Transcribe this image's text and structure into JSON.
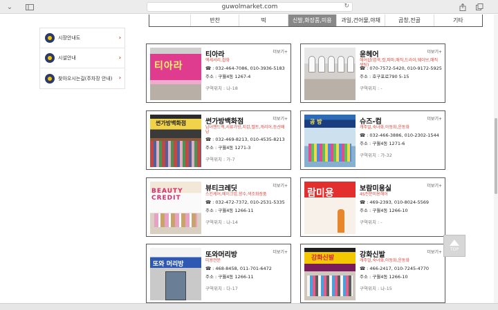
{
  "browser": {
    "url": "guwolmarket.com"
  },
  "categories": [
    {
      "label": "반찬"
    },
    {
      "label": "떡"
    },
    {
      "label": "신발,화장품,미용",
      "active": true
    },
    {
      "label": "과일,건어물,야채"
    },
    {
      "label": "곱창,전골"
    },
    {
      "label": "기타"
    }
  ],
  "sidebar": {
    "items": [
      {
        "label": "시장안내도"
      },
      {
        "label": "시설안내"
      },
      {
        "label": "찾아오시는길(주차장 안내)"
      }
    ]
  },
  "more_label": "더보기+",
  "stores": [
    {
      "name": "티아라",
      "items": "액세서리,잡화",
      "phone": "☎ : 032-464-7086, 010-3936-5183",
      "addr": "주소 : 구월4동 1267-4",
      "zone": "구역위치 : 나-18",
      "sign": "티아라"
    },
    {
      "name": "윤헤어",
      "items": "헤어샵(염색,컷,파마,매직,드라이,웨이브,매직셋팅)",
      "phone": "☎ : 070-7572-5420, 010-9172-5925",
      "addr": "주소 : 호구포로790 5-15",
      "zone": "구역위치 : -",
      "sign": ""
    },
    {
      "name": "썬가방백화점",
      "items": "남녀핸드백,서류가방,지갑,벨트,캐리어,등산배낭",
      "phone": "☎ : 032-469-8213, 010-4535-8213",
      "addr": "주소 : 구월4동 1271-3",
      "zone": "구역위치 : 가-7",
      "sign": "썬가방백화점"
    },
    {
      "name": "슈즈-컴",
      "items": "캐주얼,숙녀화,아동화,운동화",
      "phone": "☎ : 032-466-3886, 010-2302-1544",
      "addr": "주소 : 구월4동 1271-6",
      "zone": "구역위치 : 가-32",
      "sign": "공 방"
    },
    {
      "name": "뷰티크레딧",
      "items": "스킨케어,메이크업,향수,색조화장품",
      "phone": "☎ : 032-472-7372, 010-2531-5335",
      "addr": "주소 : 구월4동 1266-11",
      "zone": "구역위치 : 나-14",
      "sign": "BEAUTY CREDIT"
    },
    {
      "name": "보람미용실",
      "items": "4S전문미용헤어",
      "phone": "☎ : 469-2393, 010-8024-5569",
      "addr": "주소 : 구월4동 1266-10",
      "zone": "구역위치 : -",
      "sign": "람미용"
    },
    {
      "name": "또와머리방",
      "items": "미용전문",
      "phone": "☎ : 468-8458, 011-701-6472",
      "addr": "주소 : 구월4동 1266-11",
      "zone": "구역위치 : 다-17",
      "sign": "또와 머리방"
    },
    {
      "name": "강화신발",
      "items": "캐주얼,숙녀화,아동화,운동화",
      "phone": "☎ : 466-2417, 010-7245-4770",
      "addr": "주소 : 구월4동 1266-10",
      "zone": "구역위치 : 나-15",
      "sign": "강화신발"
    }
  ],
  "top_button": {
    "label": "TOP"
  }
}
